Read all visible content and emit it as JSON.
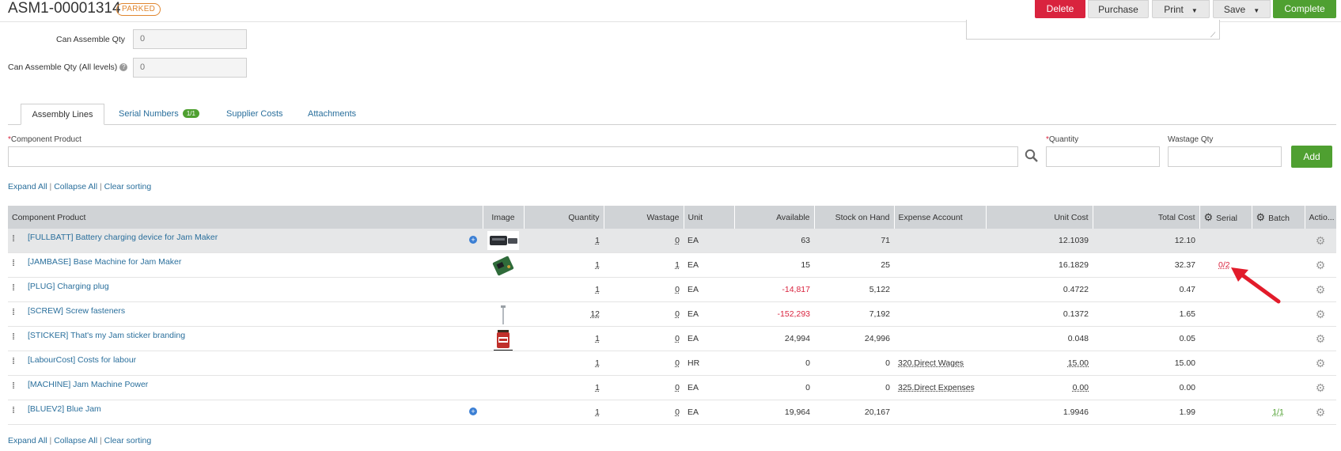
{
  "header": {
    "title": "ASM1-00001314",
    "status": "PARKED",
    "buttons": {
      "delete": "Delete",
      "purchase": "Purchase",
      "print": "Print",
      "save": "Save",
      "complete": "Complete"
    }
  },
  "fields": {
    "can_assemble_qty": {
      "label": "Can Assemble Qty",
      "value": "0"
    },
    "can_assemble_qty_all": {
      "label": "Can Assemble Qty (All levels)",
      "value": "0"
    }
  },
  "tabs": {
    "assembly_lines": "Assembly Lines",
    "serial_numbers": "Serial Numbers",
    "serial_badge": "1/1",
    "supplier_costs": "Supplier Costs",
    "attachments": "Attachments"
  },
  "add_form": {
    "component_label": "Component Product",
    "quantity_label": "Quantity",
    "wastage_label": "Wastage Qty",
    "required_mark": "*",
    "add_button": "Add"
  },
  "links": {
    "expand_all": "Expand All",
    "collapse_all": "Collapse All",
    "clear_sorting": "Clear sorting",
    "separator": "|"
  },
  "table": {
    "headers": {
      "component_product": "Component Product",
      "image": "Image",
      "quantity": "Quantity",
      "wastage": "Wastage",
      "unit": "Unit",
      "available": "Available",
      "stock_on_hand": "Stock on Hand",
      "expense_account": "Expense Account",
      "unit_cost": "Unit Cost",
      "total_cost": "Total Cost",
      "serial": "Serial",
      "batch": "Batch",
      "actions": "Actio..."
    },
    "rows": [
      {
        "product": "[FULLBATT] Battery charging device for Jam Maker",
        "quantity": "1",
        "wastage": "0",
        "unit": "EA",
        "available": "63",
        "stock": "71",
        "expense": "",
        "unit_cost": "12.1039",
        "total_cost": "12.10",
        "serial": "",
        "batch": ""
      },
      {
        "product": "[JAMBASE] Base Machine for Jam Maker",
        "quantity": "1",
        "wastage": "1",
        "unit": "EA",
        "available": "15",
        "stock": "25",
        "expense": "",
        "unit_cost": "16.1829",
        "total_cost": "32.37",
        "serial": "0/2",
        "batch": ""
      },
      {
        "product": "[PLUG] Charging plug",
        "quantity": "1",
        "wastage": "0",
        "unit": "EA",
        "available": "-14,817",
        "stock": "5,122",
        "expense": "",
        "unit_cost": "0.4722",
        "total_cost": "0.47",
        "serial": "",
        "batch": ""
      },
      {
        "product": "[SCREW] Screw fasteners",
        "quantity": "12",
        "wastage": "0",
        "unit": "EA",
        "available": "-152,293",
        "stock": "7,192",
        "expense": "",
        "unit_cost": "0.1372",
        "total_cost": "1.65",
        "serial": "",
        "batch": ""
      },
      {
        "product": "[STICKER] That's my Jam sticker branding",
        "quantity": "1",
        "wastage": "0",
        "unit": "EA",
        "available": "24,994",
        "stock": "24,996",
        "expense": "",
        "unit_cost": "0.048",
        "total_cost": "0.05",
        "serial": "",
        "batch": ""
      },
      {
        "product": "[LabourCost] Costs for labour",
        "quantity": "1",
        "wastage": "0",
        "unit": "HR",
        "available": "0",
        "stock": "0",
        "expense": "320.Direct Wages",
        "unit_cost": "15.00",
        "total_cost": "15.00",
        "serial": "",
        "batch": ""
      },
      {
        "product": "[MACHINE] Jam Machine Power",
        "quantity": "1",
        "wastage": "0",
        "unit": "EA",
        "available": "0",
        "stock": "0",
        "expense": "325.Direct Expenses",
        "unit_cost": "0.00",
        "total_cost": "0.00",
        "serial": "",
        "batch": ""
      },
      {
        "product": "[BLUEV2] Blue Jam",
        "quantity": "1",
        "wastage": "0",
        "unit": "EA",
        "available": "19,964",
        "stock": "20,167",
        "expense": "",
        "unit_cost": "1.9946",
        "total_cost": "1.99",
        "serial": "",
        "batch": "1/1"
      }
    ]
  },
  "colors": {
    "danger": "#d9233e",
    "success": "#4fa031",
    "link": "#2a6f9c",
    "warning": "#e0862f",
    "header_bg": "#d0d3d6"
  },
  "icons": {
    "search": "search-icon",
    "gear": "gear-icon",
    "drag": "drag-handle-icon",
    "expand": "plus-circle-icon",
    "help": "question-icon",
    "arrow": "red-arrow-annotation"
  }
}
